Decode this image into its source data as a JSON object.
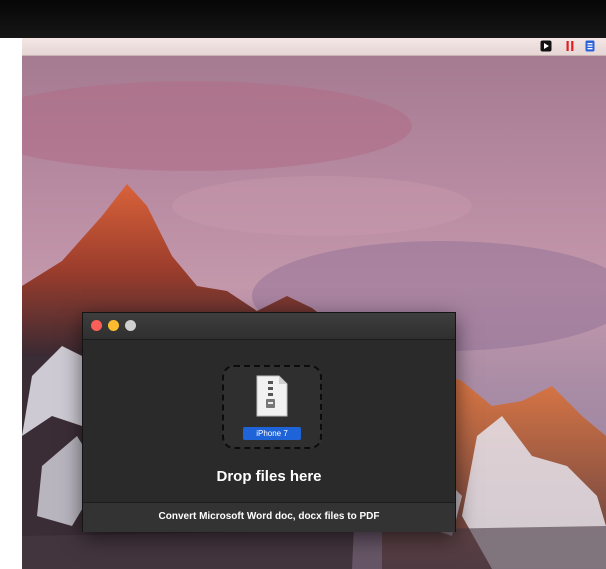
{
  "menubar": {
    "icons": [
      "play-square-icon",
      "pause-icon",
      "document-icon"
    ],
    "colors": {
      "play": "#111111",
      "pause": "#e02020",
      "document": "#2b63d9"
    }
  },
  "window": {
    "traffic_colors": {
      "close": "#fc5f58",
      "minimize": "#fdbc2f",
      "zoom": "#cfcfcf"
    },
    "file_label": "iPhone 7",
    "drop_text": "Drop files here",
    "footer_text": "Convert Microsoft Word doc, docx files to PDF",
    "selection_color": "#1f63d8"
  }
}
